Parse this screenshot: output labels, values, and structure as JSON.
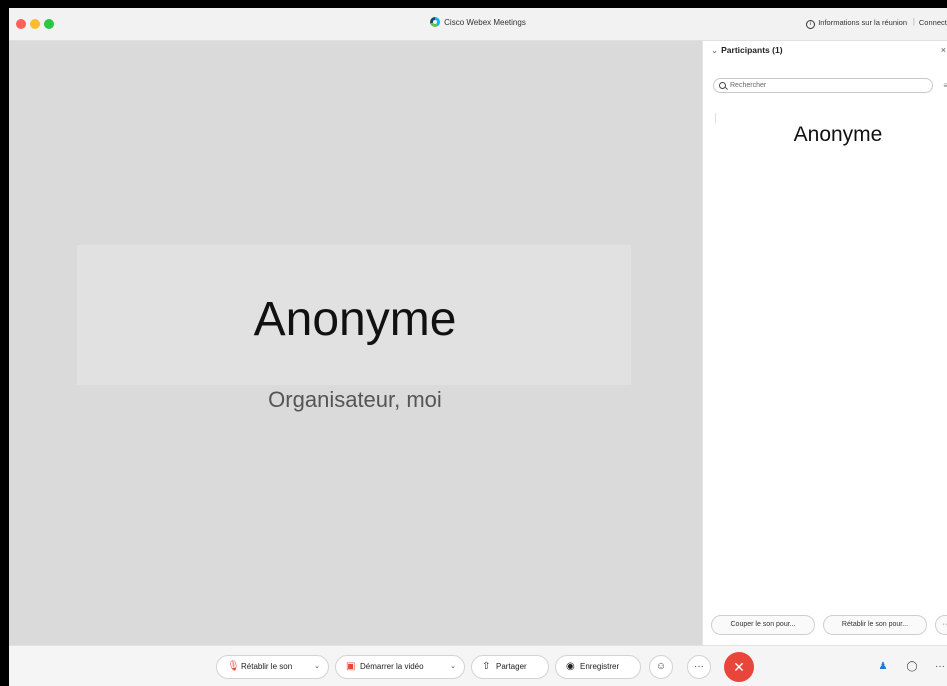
{
  "window": {
    "title": "Cisco Webex Meetings",
    "meeting_info": "Informations sur la réunion",
    "separator": "|",
    "status": "Connecté"
  },
  "stage": {
    "name": "Anonyme",
    "role": "Organisateur, moi"
  },
  "panel": {
    "title": "Participants (1)",
    "search_placeholder": "Rechercher",
    "participant": "Anonyme",
    "mute_all": "Couper le son pour...",
    "unmute_all": "Rétablir le son pour...",
    "more": "···"
  },
  "controls": {
    "unmute": "Rétablir le son",
    "start_video": "Démarrer la vidéo",
    "share": "Partager",
    "record": "Enregistrer",
    "more": "···",
    "side_more": "···"
  },
  "icons": {
    "close": "close-icon",
    "chevron": "chevron-down-icon",
    "leave": "leave-icon",
    "mic_muted": "mic-muted-icon",
    "video_off": "video-off-icon"
  },
  "colors": {
    "accent": "#1c7ad6",
    "danger": "#e8463a"
  }
}
